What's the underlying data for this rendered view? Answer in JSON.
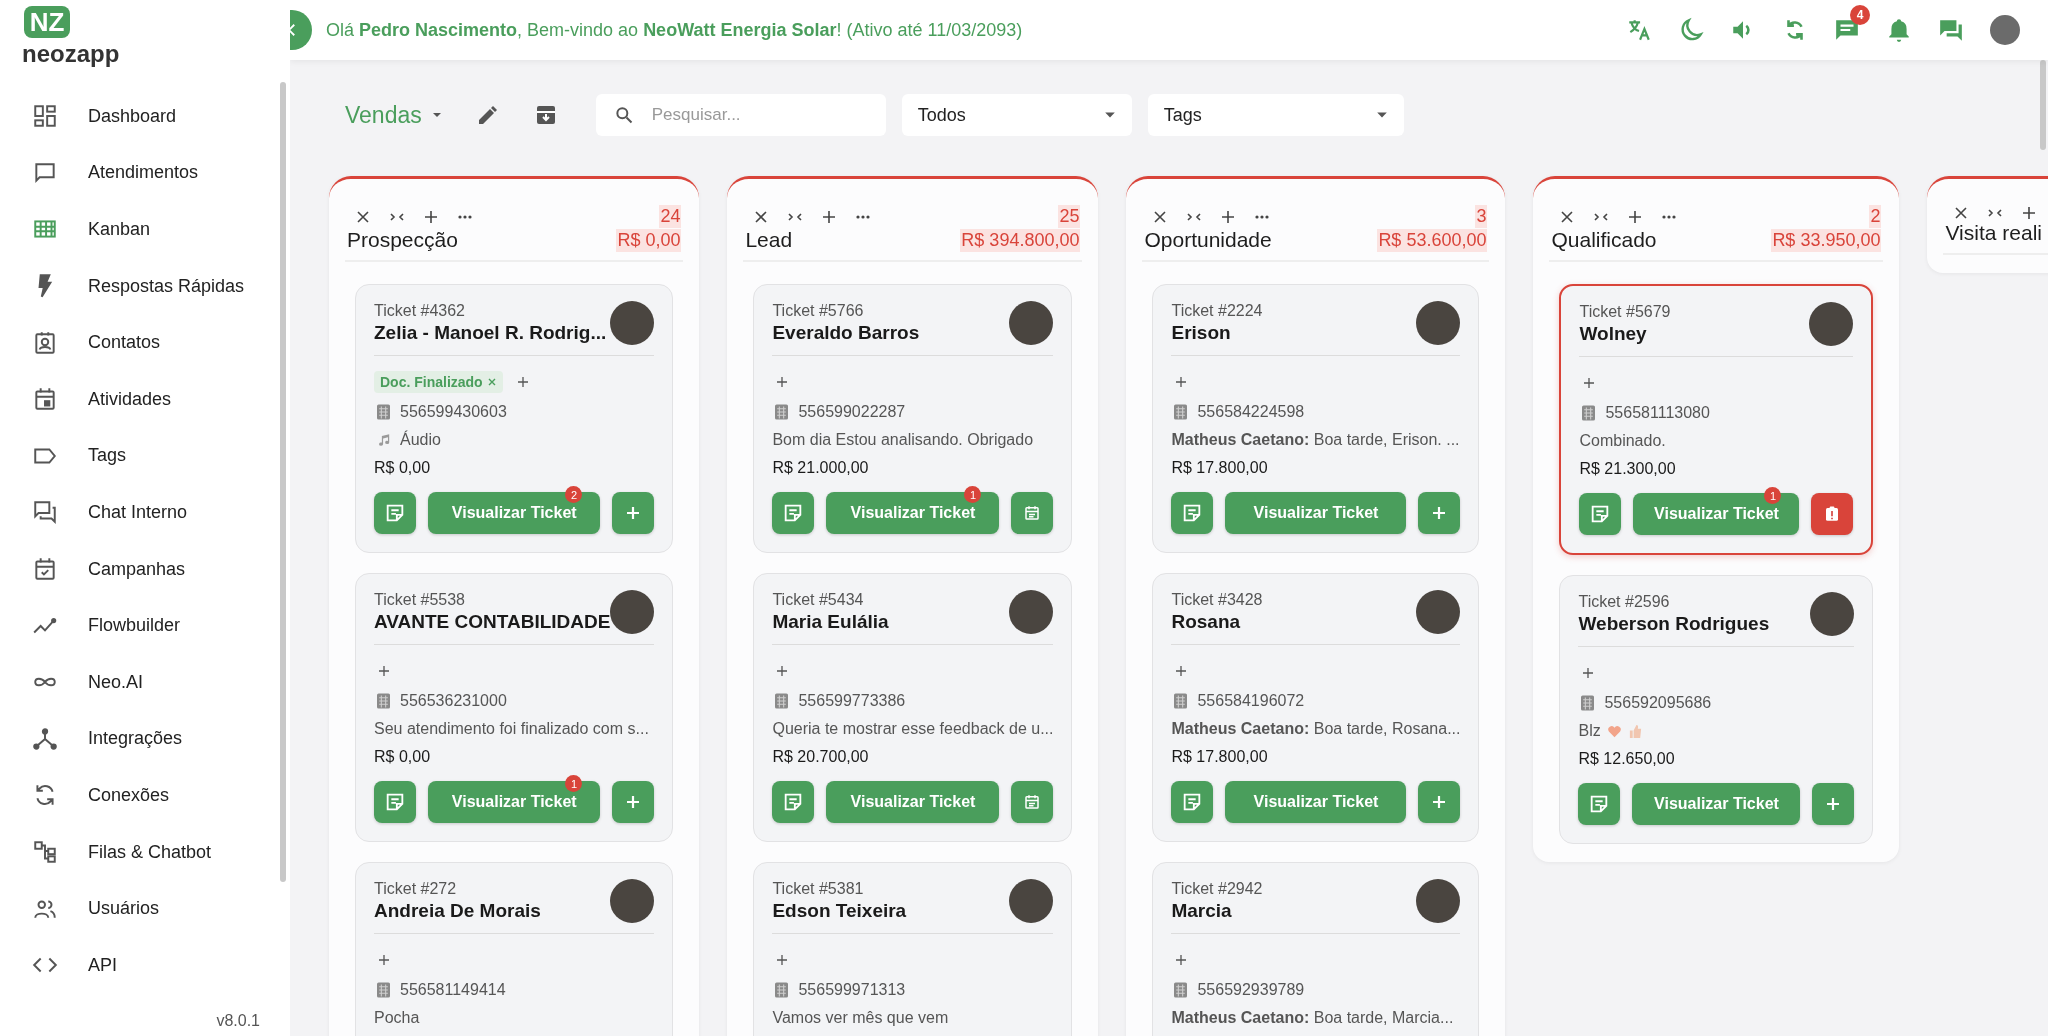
{
  "sidebar": {
    "logo_mark": "NZ",
    "logo_text": "neozapp",
    "items": [
      {
        "label": "Dashboard",
        "selected": false
      },
      {
        "label": "Atendimentos",
        "selected": false
      },
      {
        "label": "Kanban",
        "selected": true
      },
      {
        "label": "Respostas Rápidas",
        "selected": false
      },
      {
        "label": "Contatos",
        "selected": false
      },
      {
        "label": "Atividades",
        "selected": false
      },
      {
        "label": "Tags",
        "selected": false
      },
      {
        "label": "Chat Interno",
        "selected": false
      },
      {
        "label": "Campanhas",
        "selected": false
      },
      {
        "label": "Flowbuilder",
        "selected": false
      },
      {
        "label": "Neo.AI",
        "selected": false
      },
      {
        "label": "Integrações",
        "selected": false
      },
      {
        "label": "Conexões",
        "selected": false
      },
      {
        "label": "Filas & Chatbot",
        "selected": false
      },
      {
        "label": "Usuários",
        "selected": false
      },
      {
        "label": "API",
        "selected": false
      }
    ],
    "version": "v8.0.1"
  },
  "header": {
    "greeting": "Olá **Pedro Nascimento**, Bem-vindo ao **NeoWatt Energia Solar**! (Ativo até 11/03/2093)",
    "messages_badge": "4"
  },
  "toolbar": {
    "board": "Vendas",
    "search": {
      "placeholder": "Pesquisar..."
    },
    "filter": "Todos",
    "tags": "Tags"
  },
  "columns": [
    {
      "title": "Prospecção",
      "count": "24",
      "total": "R$ 0,00",
      "cards": [
        {
          "ticket": "Ticket #4362",
          "name": "Zelia - Manoel R. Rodrig...",
          "tags": [
            {
              "label": "Doc. Finalizado"
            }
          ],
          "phone": "556599430603",
          "message": {
            "kind": "audio",
            "text": "Áudio"
          },
          "value": "R$ 0,00",
          "buttons": [
            {
              "kind": "notes"
            },
            {
              "kind": "view",
              "label": "Visualizar Ticket",
              "badge": "2"
            },
            {
              "kind": "add"
            }
          ],
          "highlighted": false
        },
        {
          "ticket": "Ticket #5538",
          "name": "AVANTE CONTABILIDADE",
          "phone": "556536231000",
          "message": {
            "kind": "text",
            "text": "Seu atendimento foi finalizado com s..."
          },
          "value": "R$ 0,00",
          "buttons": [
            {
              "kind": "notes"
            },
            {
              "kind": "view",
              "label": "Visualizar Ticket",
              "badge": "1"
            },
            {
              "kind": "add"
            }
          ],
          "highlighted": false
        },
        {
          "ticket": "Ticket #272",
          "name": "Andreia De Morais",
          "phone": "556581149414",
          "message": {
            "kind": "text",
            "text": "Pocha"
          },
          "highlighted": false
        }
      ]
    },
    {
      "title": "Lead",
      "count": "25",
      "total": "R$ 394.800,00",
      "cards": [
        {
          "ticket": "Ticket #5766",
          "name": "Everaldo Barros",
          "phone": "556599022287",
          "message": {
            "kind": "text",
            "text": "Bom dia Estou analisando. Obrigado"
          },
          "value": "R$ 21.000,00",
          "buttons": [
            {
              "kind": "notes"
            },
            {
              "kind": "view",
              "label": "Visualizar Ticket",
              "badge": "1"
            },
            {
              "kind": "schedule"
            }
          ],
          "highlighted": false
        },
        {
          "ticket": "Ticket #5434",
          "name": "Maria Eulália",
          "phone": "556599773386",
          "message": {
            "kind": "text",
            "text": "Queria te mostrar esse feedback de u..."
          },
          "value": "R$ 20.700,00",
          "buttons": [
            {
              "kind": "notes"
            },
            {
              "kind": "view",
              "label": "Visualizar Ticket"
            },
            {
              "kind": "schedule"
            }
          ],
          "highlighted": false
        },
        {
          "ticket": "Ticket #5381",
          "name": "Edson Teixeira",
          "phone": "556599971313",
          "message": {
            "kind": "text",
            "text": "Vamos ver mês que vem"
          },
          "highlighted": false
        }
      ]
    },
    {
      "title": "Oportunidade",
      "count": "3",
      "total": "R$ 53.600,00",
      "cards": [
        {
          "ticket": "Ticket #2224",
          "name": "Erison",
          "phone": "556584224598",
          "message": {
            "kind": "text",
            "text": "**Matheus Caetano:** Boa tarde, Erison. ..."
          },
          "value": "R$ 17.800,00",
          "buttons": [
            {
              "kind": "notes"
            },
            {
              "kind": "view",
              "label": "Visualizar Ticket"
            },
            {
              "kind": "add"
            }
          ],
          "highlighted": false
        },
        {
          "ticket": "Ticket #3428",
          "name": "Rosana",
          "phone": "556584196072",
          "message": {
            "kind": "text",
            "text": "**Matheus Caetano:** Boa tarde, Rosana..."
          },
          "value": "R$ 17.800,00",
          "buttons": [
            {
              "kind": "notes"
            },
            {
              "kind": "view",
              "label": "Visualizar Ticket"
            },
            {
              "kind": "add"
            }
          ],
          "highlighted": false
        },
        {
          "ticket": "Ticket #2942",
          "name": "Marcia",
          "phone": "556592939789",
          "message": {
            "kind": "text",
            "text": "**Matheus Caetano:** Boa tarde, Marcia..."
          },
          "highlighted": false
        }
      ]
    },
    {
      "title": "Qualificado",
      "count": "2",
      "total": "R$ 33.950,00",
      "cards": [
        {
          "ticket": "Ticket #5679",
          "name": "Wolney",
          "phone": "556581113080",
          "message": {
            "kind": "text",
            "text": "Combinado."
          },
          "value": "R$ 21.300,00",
          "buttons": [
            {
              "kind": "notes"
            },
            {
              "kind": "view",
              "label": "Visualizar Ticket",
              "badge": "1"
            },
            {
              "kind": "alert"
            }
          ],
          "highlighted": true
        },
        {
          "ticket": "Ticket #2596",
          "name": "Weberson Rodrigues",
          "phone": "556592095686",
          "message": {
            "kind": "emoji",
            "text": "Blz",
            "emojis": [
              {
                "kind": "heart"
              },
              {
                "kind": "thumbs_up"
              }
            ]
          },
          "value": "R$ 12.650,00",
          "buttons": [
            {
              "kind": "notes"
            },
            {
              "kind": "view",
              "label": "Visualizar Ticket"
            },
            {
              "kind": "add"
            }
          ],
          "highlighted": false
        }
      ]
    },
    {
      "title": "Visita reali"
    }
  ]
}
